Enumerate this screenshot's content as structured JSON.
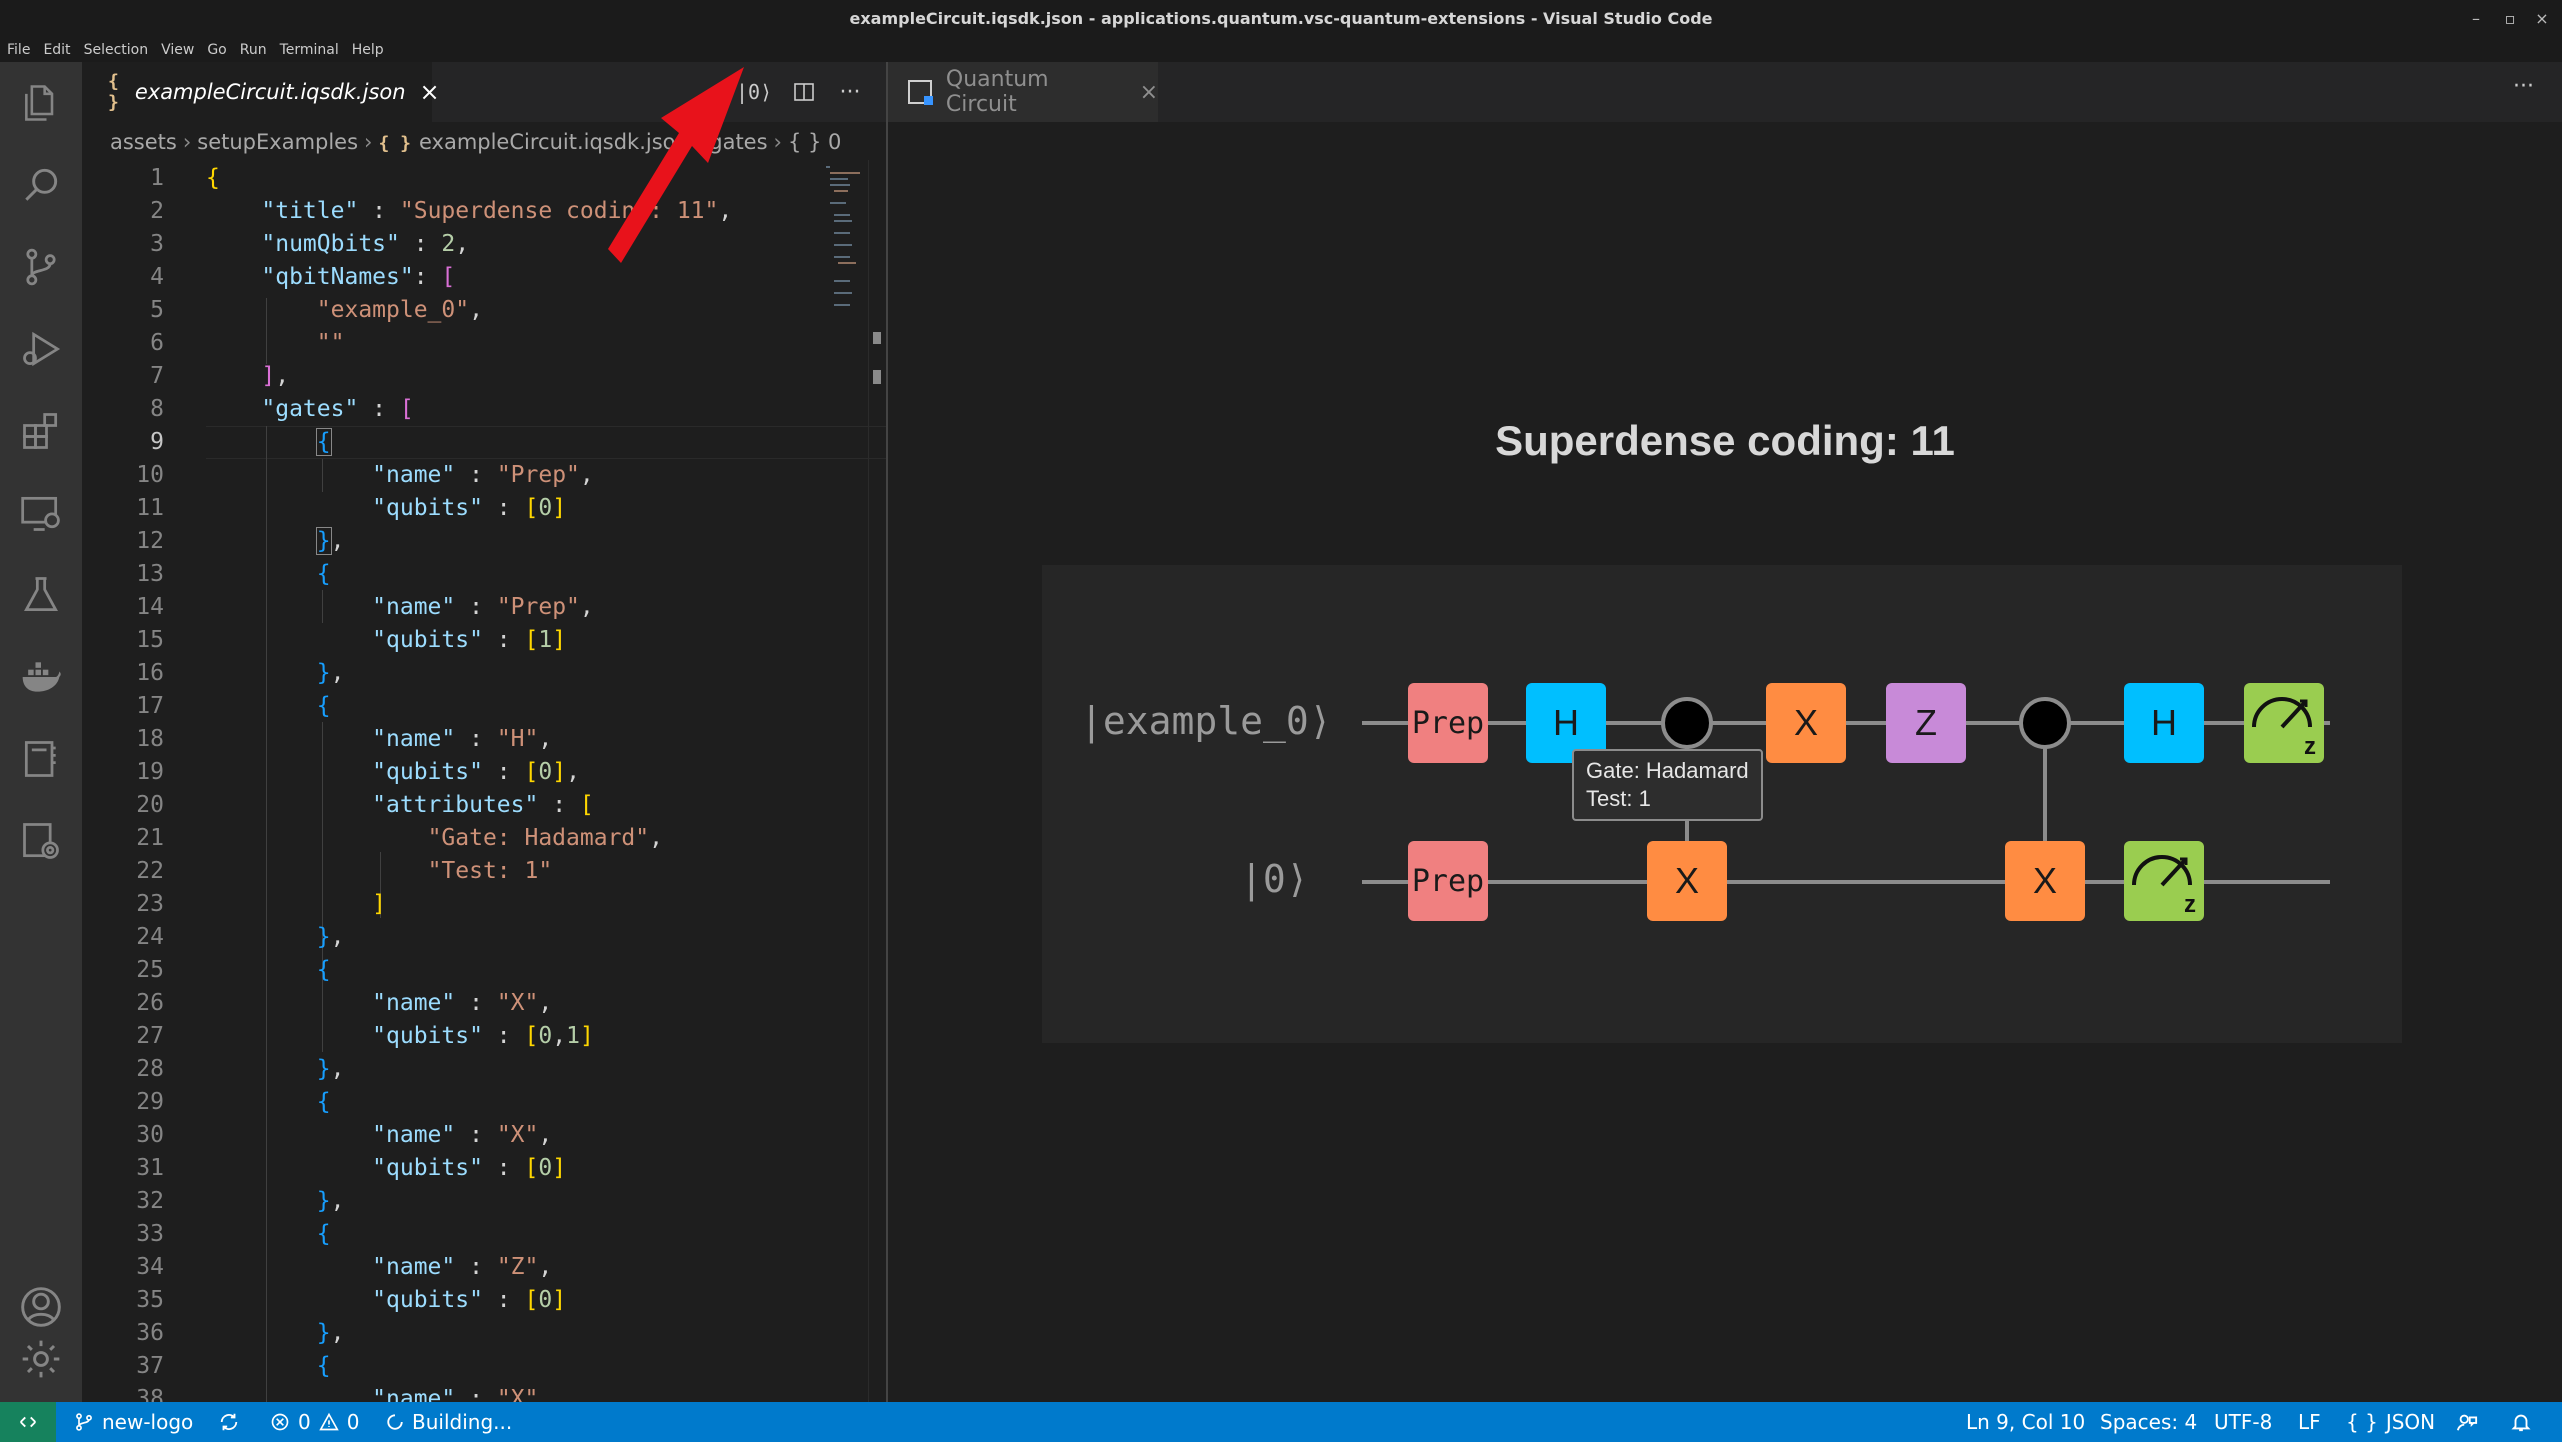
{
  "window": {
    "title": "exampleCircuit.iqsdk.json - applications.quantum.vsc-quantum-extensions - Visual Studio Code",
    "controls": [
      "–",
      "▫",
      "×"
    ]
  },
  "menu": [
    "File",
    "Edit",
    "Selection",
    "View",
    "Go",
    "Run",
    "Terminal",
    "Help"
  ],
  "activity_bar": [
    "files-icon",
    "search-icon",
    "source-control-icon",
    "run-debug-icon",
    "extensions-icon",
    "remote-explorer-icon",
    "testing-icon",
    "docker-icon",
    "notebook-icon",
    "quantum-settings-icon",
    "account-icon",
    "gear-icon"
  ],
  "editor": {
    "tab": {
      "icon": "{ }",
      "label": "exampleCircuit.iqsdk.json",
      "close": "×"
    },
    "toolbar": {
      "preview": "|0⟩",
      "split": "split-editor-icon",
      "more": "···"
    },
    "breadcrumb": [
      "assets",
      "setupExamples",
      "exampleCircuit.iqsdk.json",
      "gates",
      "{ } 0"
    ],
    "line_numbers": [
      "1",
      "2",
      "3",
      "4",
      "5",
      "6",
      "7",
      "8",
      "9",
      "10",
      "11",
      "12",
      "13",
      "14",
      "15",
      "16",
      "17",
      "18",
      "19",
      "20",
      "21",
      "22",
      "23",
      "24",
      "25",
      "26",
      "27",
      "28",
      "29",
      "30",
      "31",
      "32",
      "33",
      "34",
      "35",
      "36",
      "37",
      "38"
    ],
    "current_line": "9"
  },
  "quantum_panel": {
    "tab": {
      "label": "Quantum Circuit",
      "close": "×"
    },
    "more": "···",
    "title": "Superdense coding: 11",
    "qubits": [
      "|example_0⟩",
      "|0⟩"
    ],
    "gates_row0": [
      "Prep",
      "H",
      "X",
      "Z",
      "H"
    ],
    "gates_row1": [
      "Prep",
      "X",
      "X"
    ],
    "measure_label": "z",
    "tooltip": [
      "Gate: Hadamard",
      "Test: 1"
    ]
  },
  "status_bar": {
    "branch": "new-logo",
    "errors": "0",
    "warnings": "0",
    "building": "Building...",
    "position": "Ln 9, Col 10",
    "spaces": "Spaces: 4",
    "encoding": "UTF-8",
    "eol": "LF",
    "language_icon": "{ }",
    "language": "JSON"
  },
  "colors": {
    "accent": "#007acc",
    "remote": "#16825d",
    "prep": "#f08080",
    "h": "#00bfff",
    "x": "#ff8c42",
    "z": "#c88ad8",
    "measure": "#9acd50",
    "arrow": "#e8121b"
  }
}
